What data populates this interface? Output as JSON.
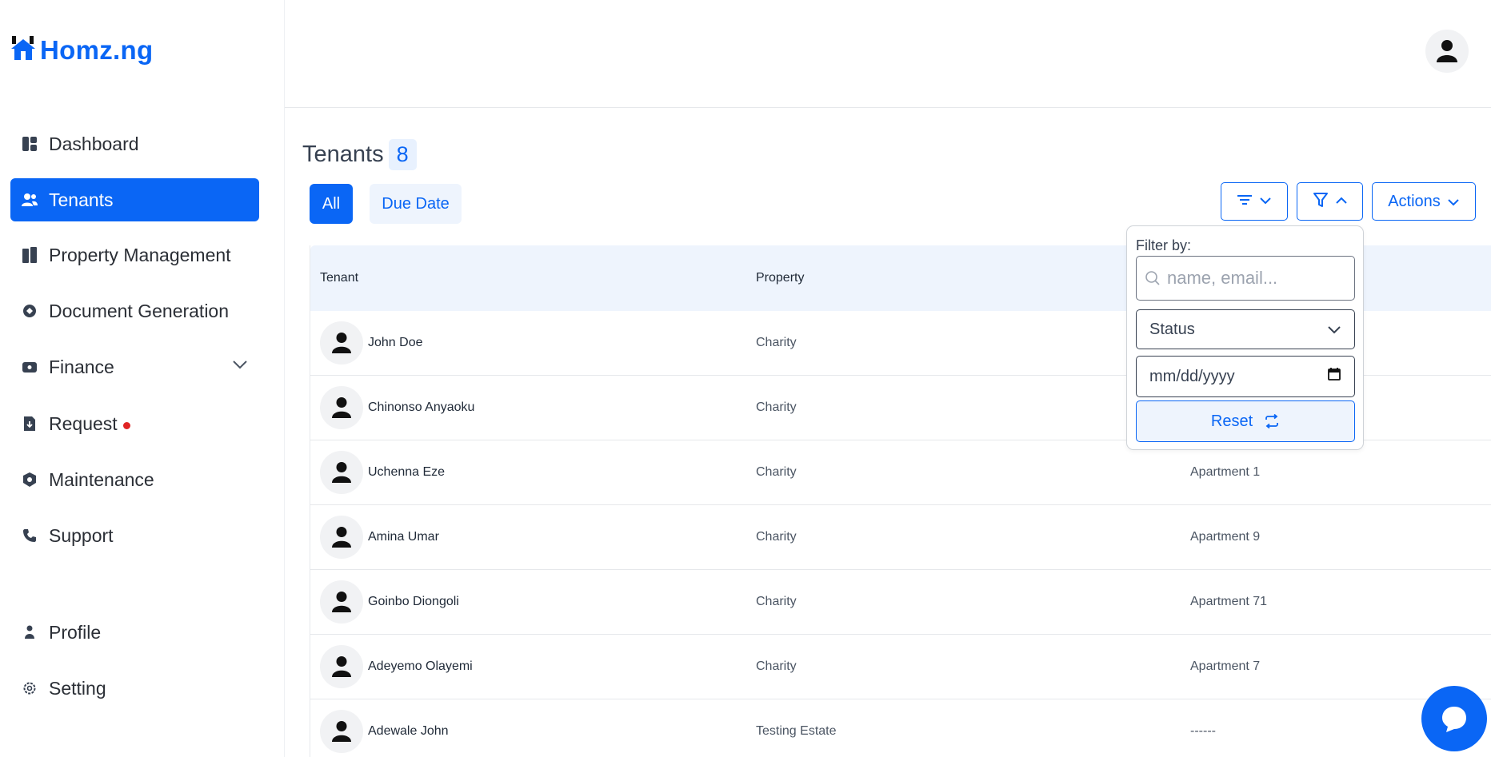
{
  "brand": {
    "name": "Homz.ng",
    "accent": "#0a66f5"
  },
  "sidebar": {
    "items": [
      {
        "label": "Dashboard",
        "icon": "dashboard-icon"
      },
      {
        "label": "Tenants",
        "icon": "users-icon",
        "active": true
      },
      {
        "label": "Property Management",
        "icon": "building-icon"
      },
      {
        "label": "Document Generation",
        "icon": "document-icon"
      },
      {
        "label": "Finance",
        "icon": "wallet-icon",
        "expandable": true
      },
      {
        "label": "Request",
        "icon": "request-icon",
        "badge": "dot"
      },
      {
        "label": "Maintenance",
        "icon": "shield-icon"
      },
      {
        "label": "Support",
        "icon": "phone-icon"
      },
      {
        "label": "Profile",
        "icon": "person-icon"
      },
      {
        "label": "Setting",
        "icon": "gear-icon"
      }
    ]
  },
  "page": {
    "title": "Tenants",
    "count": "8",
    "tabs": [
      {
        "label": "All"
      },
      {
        "label": "Due Date"
      }
    ],
    "actions_label": "Actions"
  },
  "table": {
    "columns": [
      "Tenant",
      "Property"
    ],
    "rows": [
      {
        "tenant": "John Doe",
        "property": "Charity",
        "unit": ""
      },
      {
        "tenant": "Chinonso Anyaoku",
        "property": "Charity",
        "unit": ""
      },
      {
        "tenant": "Uchenna Eze",
        "property": "Charity",
        "unit": "Apartment 1"
      },
      {
        "tenant": "Amina Umar",
        "property": "Charity",
        "unit": "Apartment 9"
      },
      {
        "tenant": "Goinbo Diongoli",
        "property": "Charity",
        "unit": "Apartment 71"
      },
      {
        "tenant": "Adeyemo Olayemi",
        "property": "Charity",
        "unit": "Apartment 7"
      },
      {
        "tenant": "Adewale John",
        "property": "Testing Estate",
        "unit": "------"
      }
    ]
  },
  "filter": {
    "label": "Filter by:",
    "search_placeholder": "name, email...",
    "status_label": "Status",
    "date_placeholder": "mm/dd/yyyy",
    "reset_label": "Reset"
  }
}
